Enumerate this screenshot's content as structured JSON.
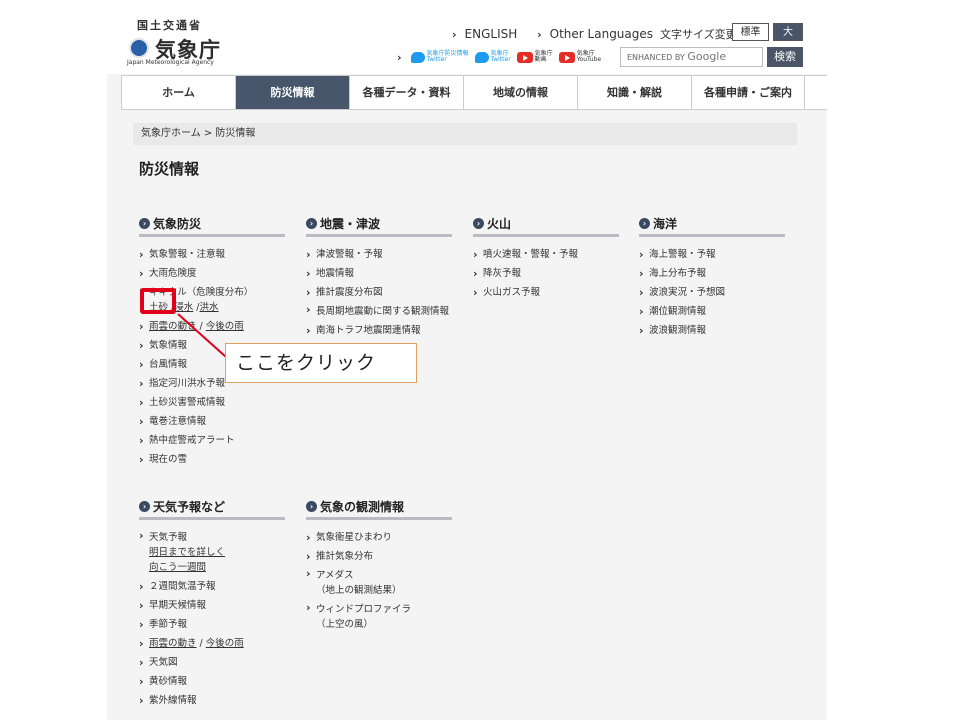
{
  "header": {
    "ministry": "国土交通省",
    "agency": "気象庁",
    "agency_en": "Japan Meteorological Agency",
    "links": [
      "ENGLISH",
      "Other Languages"
    ],
    "font_size_label": "文字サイズ変更",
    "font_standard": "標準",
    "font_large": "大",
    "search_placeholder_prefix": "ENHANCED BY",
    "search_placeholder_brand": "Google",
    "search_button": "検索",
    "social": [
      {
        "icon": "twitter-icon",
        "line1": "気象庁防災情報",
        "line2": "Twitter"
      },
      {
        "icon": "twitter-icon",
        "line1": "気象庁",
        "line2": "Twitter"
      },
      {
        "icon": "youtube-icon",
        "line1": "気象庁",
        "line2": "動画"
      },
      {
        "icon": "youtube-icon",
        "line1": "気象庁",
        "line2": "YouTube"
      }
    ]
  },
  "nav": [
    "ホーム",
    "防災情報",
    "各種データ・資料",
    "地域の情報",
    "知識・解説",
    "各種申請・ご案内"
  ],
  "breadcrumb": "気象庁ホーム > 防災情報",
  "page_title": "防災情報",
  "sections": {
    "weather_disaster": {
      "title": "気象防災",
      "items": [
        "気象警報・注意報",
        "大雨危険度",
        "キキクル（危険度分布）"
      ],
      "kikikuru_links": [
        "土砂",
        "浸水",
        "洪水"
      ],
      "rain_links": [
        "雨雲の動き",
        "今後の雨"
      ],
      "items2": [
        "気象情報",
        "台風情報",
        "指定河川洪水予報",
        "土砂災害警戒情報",
        "竜巻注意情報",
        "熱中症警戒アラート",
        "現在の雪"
      ]
    },
    "earthquake": {
      "title": "地震・津波",
      "items": [
        "津波警報・予報",
        "地震情報",
        "推計震度分布図",
        "長周期地震動に関する観測情報",
        "南海トラフ地震関連情報"
      ]
    },
    "volcano": {
      "title": "火山",
      "items": [
        "噴火速報・警報・予報",
        "降灰予報",
        "火山ガス予報"
      ]
    },
    "ocean": {
      "title": "海洋",
      "items": [
        "海上警報・予報",
        "海上分布予報",
        "波浪実況・予想図",
        "潮位観測情報",
        "波浪観測情報"
      ]
    },
    "forecast": {
      "title": "天気予報など",
      "first": "天気予報",
      "first_links": [
        "明日までを詳しく",
        "向こう一週間"
      ],
      "items": [
        "２週間気温予報",
        "早期天候情報",
        "季節予報"
      ],
      "rain_links": [
        "雨雲の動き",
        "今後の雨"
      ],
      "items2": [
        "天気図",
        "黄砂情報",
        "紫外線情報"
      ]
    },
    "observation": {
      "title": "気象の観測情報",
      "items": [
        "気象衛星ひまわり",
        "推計気象分布"
      ],
      "amedas": "アメダス",
      "amedas_sub": "（地上の観測結果）",
      "profiler": "ウィンドプロファイラ",
      "profiler_sub": "（上空の風）"
    }
  },
  "annotation": {
    "callout": "ここをクリック",
    "color": "#e0001b"
  }
}
